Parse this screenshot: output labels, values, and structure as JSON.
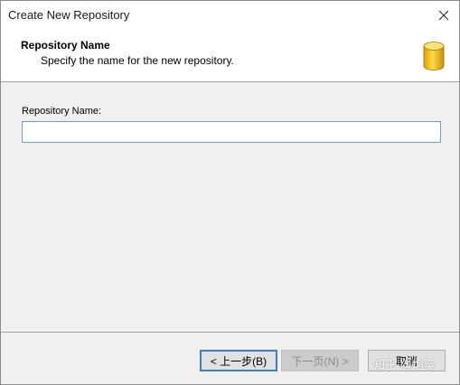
{
  "window": {
    "title": "Create New Repository"
  },
  "header": {
    "title": "Repository Name",
    "subtitle": "Specify the name for the new repository.",
    "icon": "database-icon"
  },
  "form": {
    "name_label": "Repository Name:",
    "name_value": "",
    "name_placeholder": ""
  },
  "buttons": {
    "back_label": "< 上一步(B)",
    "next_label": "下一页(N) >",
    "cancel_label": "取消"
  },
  "watermark": "知乎 @炮奕",
  "colors": {
    "accent": "#3c7fd1",
    "input_border": "#6f9fd8",
    "database_icon": "#f2c200"
  }
}
